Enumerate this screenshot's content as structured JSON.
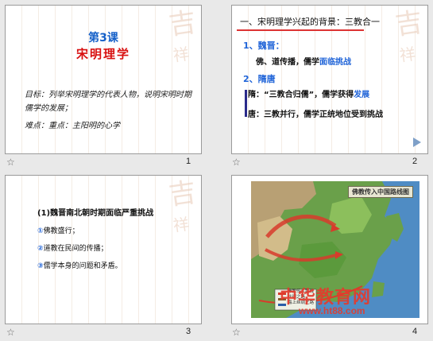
{
  "slides": [
    {
      "number": "1",
      "title_line1": "第3课",
      "title_line2": "宋明理学",
      "objective": "目标：列举宋明理学的代表人物，说明宋明时期儒学的发展；",
      "focus": "难点：重点：主阳明的心学"
    },
    {
      "number": "2",
      "heading": "一、宋明理学兴起的背景：三教合一",
      "subheading1": "1、魏晋：",
      "point1_prefix": "佛、道传播，儒学",
      "point1_highlight": "面临挑战",
      "subheading2": "2、隋唐",
      "point2_prefix": "隋：“三教合归儒”，儒学获得",
      "point2_highlight": "发展",
      "point3": "唐：三教并行，儒学正统地位受到挑战"
    },
    {
      "number": "3",
      "heading": "(1)魏晋南北朝时期面临严重挑战",
      "items": [
        {
          "num": "①",
          "text": "佛教盛行；"
        },
        {
          "num": "②",
          "text": "道教在民间的传播；"
        },
        {
          "num": "③",
          "text": "儒学本身的问题和矛盾。"
        }
      ]
    },
    {
      "number": "4",
      "map_title": "佛教传入中国路线图",
      "legend": [
        "佛教传入路线",
        "丝绸之路",
        "海上丝绸之路"
      ],
      "watermark_brand": "中华教育网",
      "watermark_url": "www.ht88.com"
    }
  ],
  "colors": {
    "accent_blue": "#1560c8",
    "accent_red": "#d81010",
    "slide_bg": "#ffffff",
    "workspace_bg": "#e9e9e9"
  },
  "icons": {
    "transition_star": "☆",
    "play": "play-triangle"
  }
}
